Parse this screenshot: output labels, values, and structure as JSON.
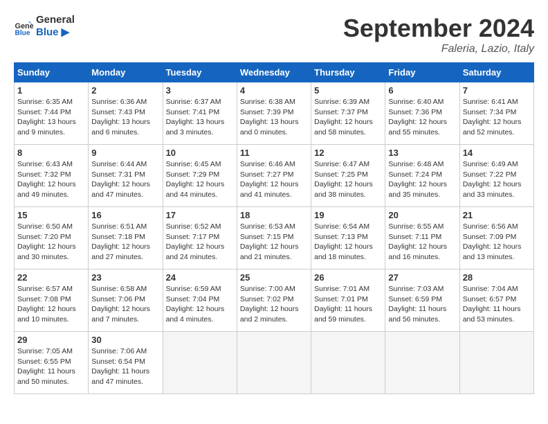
{
  "header": {
    "logo_line1": "General",
    "logo_line2": "Blue",
    "month": "September 2024",
    "location": "Faleria, Lazio, Italy"
  },
  "weekdays": [
    "Sunday",
    "Monday",
    "Tuesday",
    "Wednesday",
    "Thursday",
    "Friday",
    "Saturday"
  ],
  "weeks": [
    [
      {
        "day": "1",
        "sunrise": "6:35 AM",
        "sunset": "7:44 PM",
        "daylight": "13 hours and 9 minutes."
      },
      {
        "day": "2",
        "sunrise": "6:36 AM",
        "sunset": "7:43 PM",
        "daylight": "13 hours and 6 minutes."
      },
      {
        "day": "3",
        "sunrise": "6:37 AM",
        "sunset": "7:41 PM",
        "daylight": "13 hours and 3 minutes."
      },
      {
        "day": "4",
        "sunrise": "6:38 AM",
        "sunset": "7:39 PM",
        "daylight": "13 hours and 0 minutes."
      },
      {
        "day": "5",
        "sunrise": "6:39 AM",
        "sunset": "7:37 PM",
        "daylight": "12 hours and 58 minutes."
      },
      {
        "day": "6",
        "sunrise": "6:40 AM",
        "sunset": "7:36 PM",
        "daylight": "12 hours and 55 minutes."
      },
      {
        "day": "7",
        "sunrise": "6:41 AM",
        "sunset": "7:34 PM",
        "daylight": "12 hours and 52 minutes."
      }
    ],
    [
      {
        "day": "8",
        "sunrise": "6:43 AM",
        "sunset": "7:32 PM",
        "daylight": "12 hours and 49 minutes."
      },
      {
        "day": "9",
        "sunrise": "6:44 AM",
        "sunset": "7:31 PM",
        "daylight": "12 hours and 47 minutes."
      },
      {
        "day": "10",
        "sunrise": "6:45 AM",
        "sunset": "7:29 PM",
        "daylight": "12 hours and 44 minutes."
      },
      {
        "day": "11",
        "sunrise": "6:46 AM",
        "sunset": "7:27 PM",
        "daylight": "12 hours and 41 minutes."
      },
      {
        "day": "12",
        "sunrise": "6:47 AM",
        "sunset": "7:25 PM",
        "daylight": "12 hours and 38 minutes."
      },
      {
        "day": "13",
        "sunrise": "6:48 AM",
        "sunset": "7:24 PM",
        "daylight": "12 hours and 35 minutes."
      },
      {
        "day": "14",
        "sunrise": "6:49 AM",
        "sunset": "7:22 PM",
        "daylight": "12 hours and 33 minutes."
      }
    ],
    [
      {
        "day": "15",
        "sunrise": "6:50 AM",
        "sunset": "7:20 PM",
        "daylight": "12 hours and 30 minutes."
      },
      {
        "day": "16",
        "sunrise": "6:51 AM",
        "sunset": "7:18 PM",
        "daylight": "12 hours and 27 minutes."
      },
      {
        "day": "17",
        "sunrise": "6:52 AM",
        "sunset": "7:17 PM",
        "daylight": "12 hours and 24 minutes."
      },
      {
        "day": "18",
        "sunrise": "6:53 AM",
        "sunset": "7:15 PM",
        "daylight": "12 hours and 21 minutes."
      },
      {
        "day": "19",
        "sunrise": "6:54 AM",
        "sunset": "7:13 PM",
        "daylight": "12 hours and 18 minutes."
      },
      {
        "day": "20",
        "sunrise": "6:55 AM",
        "sunset": "7:11 PM",
        "daylight": "12 hours and 16 minutes."
      },
      {
        "day": "21",
        "sunrise": "6:56 AM",
        "sunset": "7:09 PM",
        "daylight": "12 hours and 13 minutes."
      }
    ],
    [
      {
        "day": "22",
        "sunrise": "6:57 AM",
        "sunset": "7:08 PM",
        "daylight": "12 hours and 10 minutes."
      },
      {
        "day": "23",
        "sunrise": "6:58 AM",
        "sunset": "7:06 PM",
        "daylight": "12 hours and 7 minutes."
      },
      {
        "day": "24",
        "sunrise": "6:59 AM",
        "sunset": "7:04 PM",
        "daylight": "12 hours and 4 minutes."
      },
      {
        "day": "25",
        "sunrise": "7:00 AM",
        "sunset": "7:02 PM",
        "daylight": "12 hours and 2 minutes."
      },
      {
        "day": "26",
        "sunrise": "7:01 AM",
        "sunset": "7:01 PM",
        "daylight": "11 hours and 59 minutes."
      },
      {
        "day": "27",
        "sunrise": "7:03 AM",
        "sunset": "6:59 PM",
        "daylight": "11 hours and 56 minutes."
      },
      {
        "day": "28",
        "sunrise": "7:04 AM",
        "sunset": "6:57 PM",
        "daylight": "11 hours and 53 minutes."
      }
    ],
    [
      {
        "day": "29",
        "sunrise": "7:05 AM",
        "sunset": "6:55 PM",
        "daylight": "11 hours and 50 minutes."
      },
      {
        "day": "30",
        "sunrise": "7:06 AM",
        "sunset": "6:54 PM",
        "daylight": "11 hours and 47 minutes."
      },
      null,
      null,
      null,
      null,
      null
    ]
  ]
}
